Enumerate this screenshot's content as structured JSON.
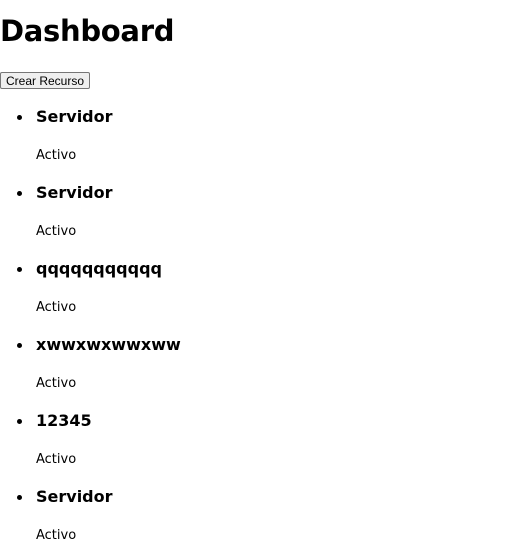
{
  "page": {
    "title": "Dashboard"
  },
  "toolbar": {
    "create_label": "Crear Recurso"
  },
  "resources": [
    {
      "name": "Servidor",
      "status": "Activo"
    },
    {
      "name": "Servidor",
      "status": "Activo"
    },
    {
      "name": "qqqqqqqqqqq",
      "status": "Activo"
    },
    {
      "name": "xwwxwxwwxww",
      "status": "Activo"
    },
    {
      "name": "12345",
      "status": "Activo"
    },
    {
      "name": "Servidor",
      "status": "Activo"
    }
  ]
}
